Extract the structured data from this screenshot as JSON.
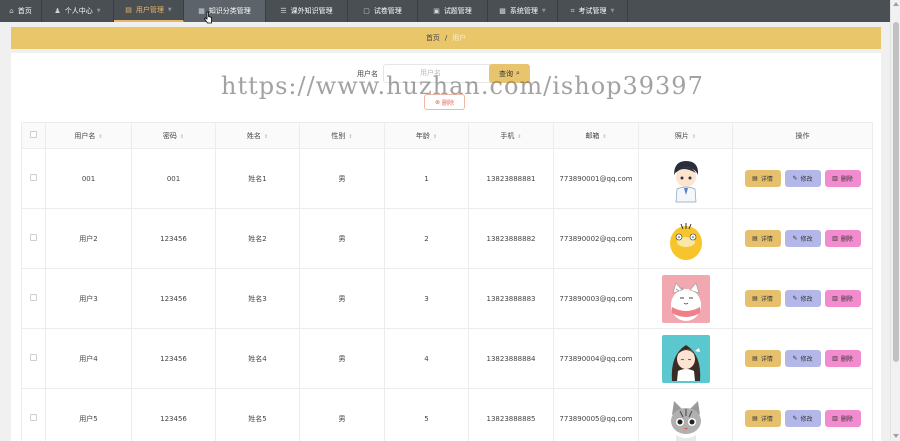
{
  "nav": [
    {
      "label": "首页",
      "icon": "home-icon",
      "glyph": "⌂",
      "active": false,
      "hover": false,
      "caret": false
    },
    {
      "label": "个人中心",
      "icon": "user-icon",
      "glyph": "♟",
      "active": false,
      "hover": false,
      "caret": true
    },
    {
      "label": "用户管理",
      "icon": "users-icon",
      "glyph": "▤",
      "active": true,
      "hover": false,
      "caret": true
    },
    {
      "label": "知识分类管理",
      "icon": "category-icon",
      "glyph": "▦",
      "active": false,
      "hover": true,
      "caret": false
    },
    {
      "label": "课外知识管理",
      "icon": "book-icon",
      "glyph": "☰",
      "active": false,
      "hover": false,
      "caret": false
    },
    {
      "label": "试卷管理",
      "icon": "paper-icon",
      "glyph": "▢",
      "active": false,
      "hover": false,
      "caret": false
    },
    {
      "label": "试题管理",
      "icon": "question-icon",
      "glyph": "▣",
      "active": false,
      "hover": false,
      "caret": false
    },
    {
      "label": "系统管理",
      "icon": "system-icon",
      "glyph": "▩",
      "active": false,
      "hover": false,
      "caret": true
    },
    {
      "label": "考试管理",
      "icon": "exam-icon",
      "glyph": "⌗",
      "active": false,
      "hover": false,
      "caret": true
    }
  ],
  "breadcrumb": {
    "home": "首页",
    "separator": "/",
    "current": "用户"
  },
  "search": {
    "label": "用户名",
    "placeholder": "用户名",
    "query_label": "查询",
    "query_icon": "⌕",
    "delete_label": "删除",
    "delete_icon": "⊗"
  },
  "watermark": "https://www.huzhan.com/ishop39397",
  "table": {
    "headers": [
      {
        "label": "",
        "check": true,
        "sort": false
      },
      {
        "label": "用户名",
        "sort": true
      },
      {
        "label": "密码",
        "sort": true
      },
      {
        "label": "姓名",
        "sort": true
      },
      {
        "label": "性别",
        "sort": true
      },
      {
        "label": "年龄",
        "sort": true
      },
      {
        "label": "手机",
        "sort": true
      },
      {
        "label": "邮箱",
        "sort": true
      },
      {
        "label": "照片",
        "sort": true
      },
      {
        "label": "操作",
        "sort": false
      }
    ],
    "actions": {
      "detail": "详情",
      "edit": "修改",
      "delete": "删除"
    },
    "rows": [
      {
        "username": "001",
        "password": "001",
        "name": "姓名1",
        "gender": "男",
        "age": "1",
        "phone": "13823888881",
        "email": "773890001@qq.com",
        "photo": "boy"
      },
      {
        "username": "用户2",
        "password": "123456",
        "name": "姓名2",
        "gender": "男",
        "age": "2",
        "phone": "13823888882",
        "email": "773890002@qq.com",
        "photo": "duck"
      },
      {
        "username": "用户3",
        "password": "123456",
        "name": "姓名3",
        "gender": "男",
        "age": "3",
        "phone": "13823888883",
        "email": "773890003@qq.com",
        "photo": "cat"
      },
      {
        "username": "用户4",
        "password": "123456",
        "name": "姓名4",
        "gender": "男",
        "age": "4",
        "phone": "13823888884",
        "email": "773890004@qq.com",
        "photo": "girl"
      },
      {
        "username": "用户5",
        "password": "123456",
        "name": "姓名5",
        "gender": "男",
        "age": "5",
        "phone": "13823888885",
        "email": "773890005@qq.com",
        "photo": "kitten"
      }
    ]
  },
  "colors": {
    "nav_bg": "#4a4f54",
    "accent": "#e8b86a",
    "breadcrumb_bg": "#eac66b",
    "detail": "#e6c06c",
    "edit": "#b3b8e9",
    "delete": "#f38bcf"
  }
}
